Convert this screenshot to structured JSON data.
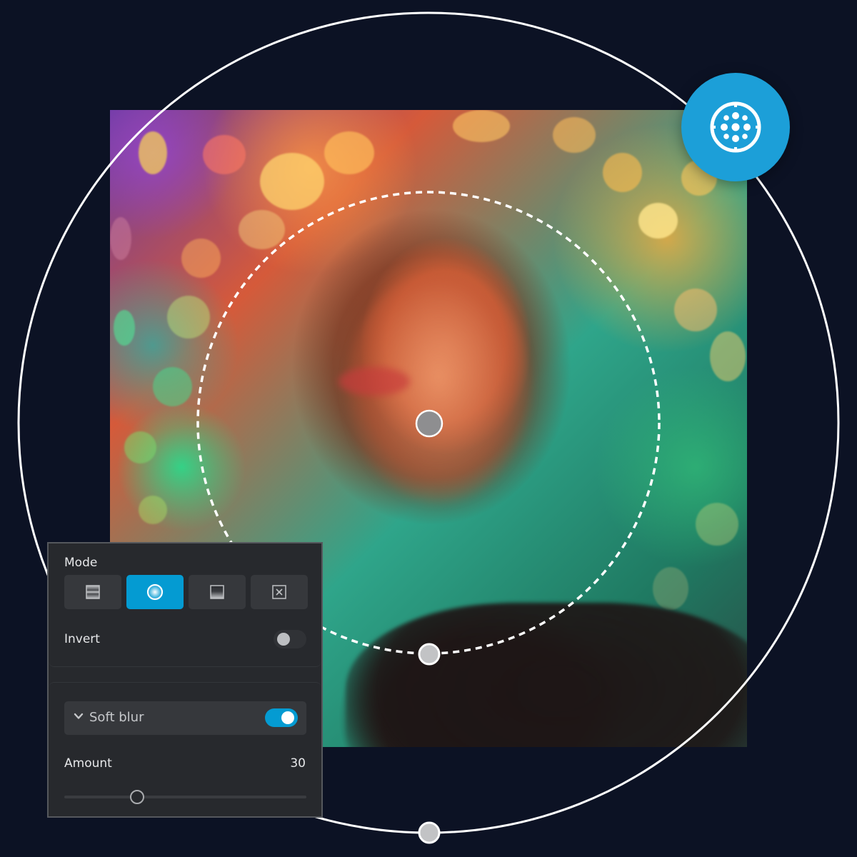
{
  "photo": {
    "subject": "portrait of red-haired woman with bokeh lights"
  },
  "colors": {
    "background": "#0c1224",
    "accent": "#049bd2",
    "badge": "#1c9fd8",
    "panel_bg": "#27292d",
    "button_bg": "#36383c",
    "handle_fill": "#c2c3c5",
    "center_handle_fill": "#8e8e90"
  },
  "badge": {
    "icon": "radial-focus-icon"
  },
  "panel": {
    "mode": {
      "label": "Mode",
      "options": [
        {
          "id": "linear",
          "icon": "linear-band-icon",
          "active": false
        },
        {
          "id": "radial",
          "icon": "radial-circle-icon",
          "active": true
        },
        {
          "id": "gradient",
          "icon": "linear-gradient-icon",
          "active": false
        },
        {
          "id": "none",
          "icon": "none-x-icon",
          "active": false
        }
      ]
    },
    "invert": {
      "label": "Invert",
      "on": false
    },
    "effect": {
      "name": "Soft blur",
      "expanded": true,
      "enabled": true
    },
    "amount": {
      "label": "Amount",
      "value": 30,
      "display": "30",
      "min": 0,
      "max": 100
    }
  }
}
